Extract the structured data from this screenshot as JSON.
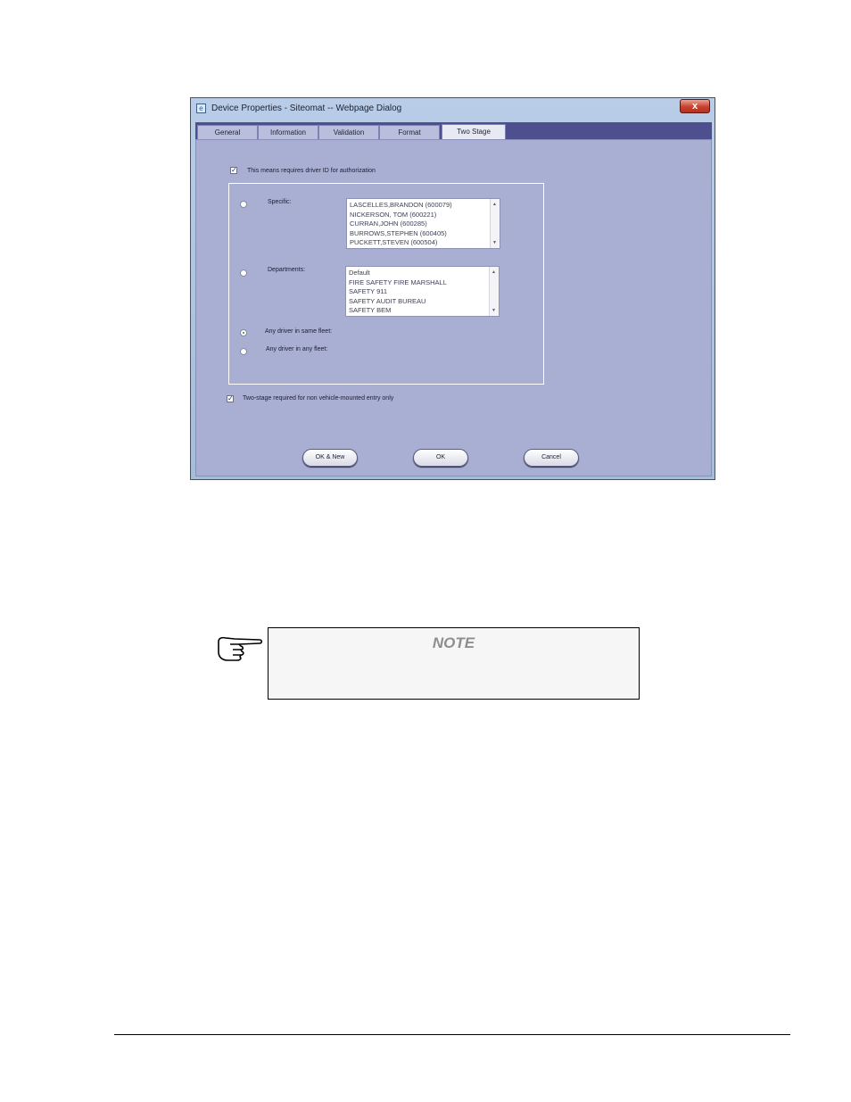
{
  "dialog": {
    "title": "Device Properties - Siteomat -- Webpage Dialog",
    "close_label": "x",
    "tabs": [
      {
        "label": "General"
      },
      {
        "label": "Information"
      },
      {
        "label": "Validation"
      },
      {
        "label": "Format"
      },
      {
        "label": "Two Stage",
        "active": true
      }
    ],
    "requires_driver_id": {
      "checked": true,
      "label": "This means requires driver ID for authorization"
    },
    "specific": {
      "label": "Specific:",
      "selected": false,
      "items": [
        "LASCELLES,BRANDON (600079)",
        "NICKERSON, TOM (600221)",
        "CURRAN,JOHN (600285)",
        "BURROWS,STEPHEN (600405)",
        "PUCKETT,STEVEN (600504)"
      ]
    },
    "departments": {
      "label": "Departments:",
      "selected": false,
      "items": [
        "Default",
        "FIRE SAFETY FIRE MARSHALL",
        "SAFETY 911",
        "SAFETY AUDIT BUREAU",
        "SAFETY BEM"
      ]
    },
    "same_fleet": {
      "label": "Any driver in same fleet:",
      "selected": true
    },
    "any_fleet": {
      "label": "Any driver in any fleet:",
      "selected": false
    },
    "non_vehicle_mounted": {
      "checked": true,
      "label": "Two-stage required for non vehicle-mounted entry only"
    },
    "buttons": {
      "ok_new": "OK & New",
      "ok": "OK",
      "cancel": "Cancel"
    }
  },
  "note": {
    "title": "NOTE"
  },
  "colors": {
    "accent_tab_strip": "#4d4f8e",
    "panel": "#a9aed3",
    "close_red": "#c8412e"
  }
}
